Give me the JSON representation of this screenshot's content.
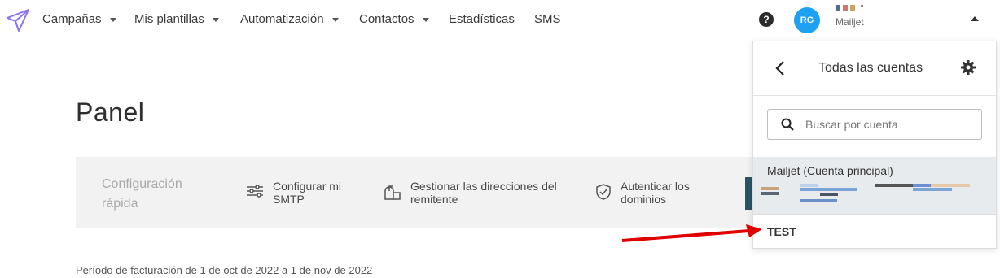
{
  "nav": {
    "items": [
      {
        "label": "Campañas",
        "has_caret": true
      },
      {
        "label": "Mis plantillas",
        "has_caret": true
      },
      {
        "label": "Automatización",
        "has_caret": true
      },
      {
        "label": "Contactos",
        "has_caret": true
      },
      {
        "label": "Estadísticas",
        "has_caret": false
      },
      {
        "label": "SMS",
        "has_caret": false
      }
    ],
    "help_icon": "?",
    "avatar_initials": "RG",
    "account_name": "Mailjet"
  },
  "page": {
    "title": "Panel",
    "quick_config_title": "Configuración rápida",
    "quick_config_items": [
      {
        "label": "Configurar mi SMTP",
        "icon": "sliders-icon"
      },
      {
        "label": "Gestionar las direcciones del remitente",
        "icon": "mailbox-icon"
      },
      {
        "label": "Autenticar los dominios",
        "icon": "shield-check-icon"
      }
    ],
    "billing_text": "Período de facturación de 1 de oct de 2022 a 1 de nov de 2022"
  },
  "accounts_panel": {
    "title": "Todas las cuentas",
    "search_placeholder": "Buscar por cuenta",
    "accounts": [
      {
        "name": "Mailjet (Cuenta principal)"
      },
      {
        "name": "TEST"
      }
    ]
  },
  "colors": {
    "accent_purple": "#7b61ff",
    "avatar_blue": "#1da1f2",
    "annotation_red": "#e00000"
  }
}
